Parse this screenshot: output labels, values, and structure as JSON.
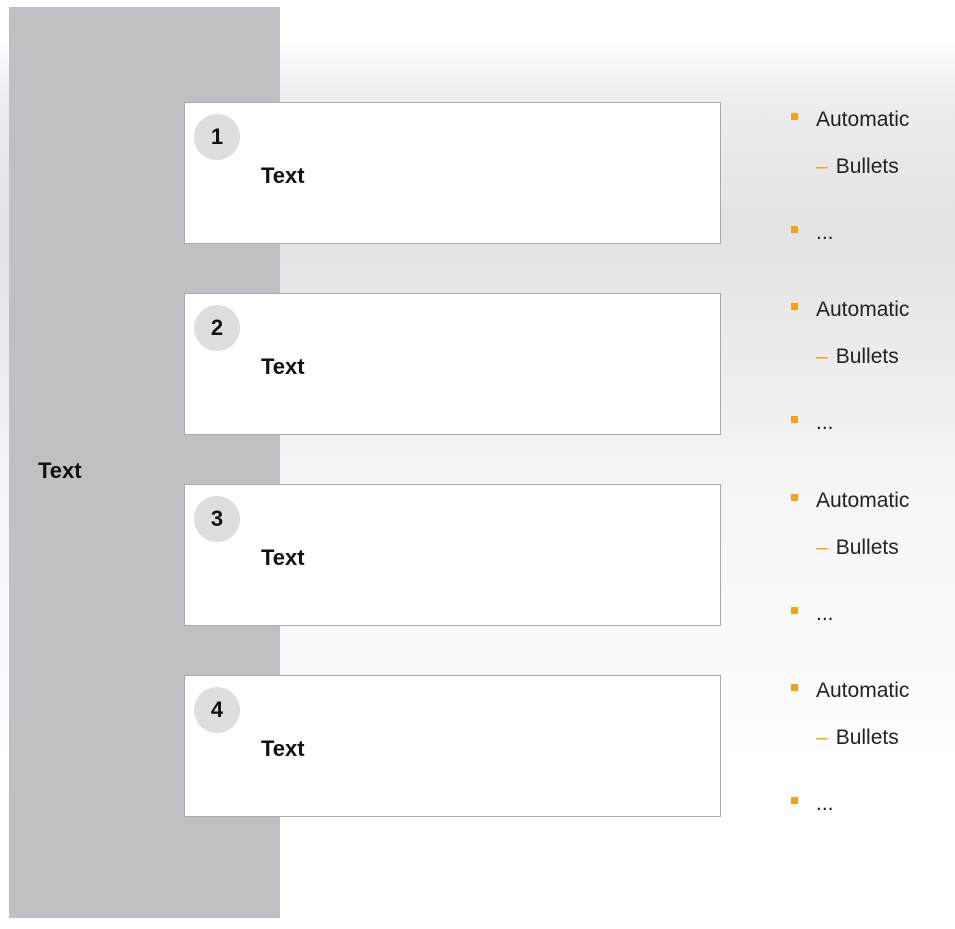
{
  "side_label": "Text",
  "steps": [
    {
      "number": "1",
      "text": "Text",
      "bullets": {
        "level1": "Automatic",
        "level2": "Bullets",
        "more": "..."
      }
    },
    {
      "number": "2",
      "text": "Text",
      "bullets": {
        "level1": "Automatic",
        "level2": "Bullets",
        "more": "..."
      }
    },
    {
      "number": "3",
      "text": "Text",
      "bullets": {
        "level1": "Automatic",
        "level2": "Bullets",
        "more": "..."
      }
    },
    {
      "number": "4",
      "text": "Text",
      "bullets": {
        "level1": "Automatic",
        "level2": "Bullets",
        "more": "..."
      }
    }
  ],
  "colors": {
    "sidebar": "#bfc0c4",
    "accent": "#f5a20f",
    "number_circle": "#dedede"
  },
  "symbols": {
    "dash": "–"
  }
}
